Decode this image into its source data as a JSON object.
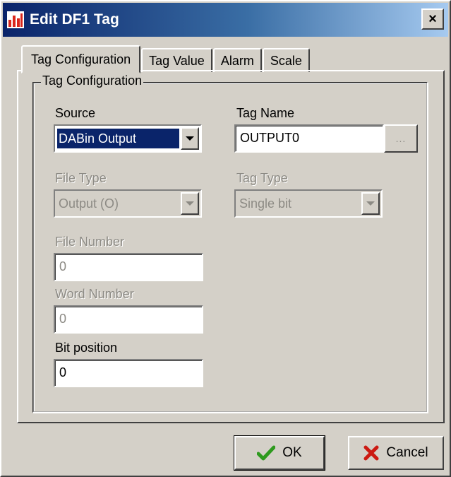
{
  "window": {
    "title": "Edit DF1 Tag",
    "close_label": "×"
  },
  "tabs": [
    {
      "label": "Tag Configuration",
      "active": true
    },
    {
      "label": "Tag Value",
      "active": false
    },
    {
      "label": "Alarm",
      "active": false
    },
    {
      "label": "Scale",
      "active": false
    }
  ],
  "group": {
    "title": "Tag Configuration"
  },
  "source": {
    "label": "Source",
    "value": "DABin Output"
  },
  "tag_name": {
    "label": "Tag Name",
    "value": "OUTPUT0",
    "browse_label": "..."
  },
  "file_type": {
    "label": "File Type",
    "value": "Output (O)",
    "enabled": false
  },
  "tag_type": {
    "label": "Tag Type",
    "value": "Single bit",
    "enabled": false
  },
  "file_number": {
    "label": "File Number",
    "value": "0",
    "enabled": false
  },
  "word_number": {
    "label": "Word Number",
    "value": "0",
    "enabled": false
  },
  "bit_position": {
    "label": "Bit position",
    "value": "0",
    "enabled": true
  },
  "buttons": {
    "ok_label": "OK",
    "cancel_label": "Cancel"
  },
  "colors": {
    "titlebar_start": "#0a246a",
    "titlebar_end": "#a6caf0",
    "dialog_face": "#d4d0c8",
    "ok_check": "#2e9a1e",
    "cancel_x": "#cc1a12"
  },
  "icons": {
    "app": "bar-chart-icon",
    "ok": "check-icon",
    "cancel": "x-icon"
  }
}
